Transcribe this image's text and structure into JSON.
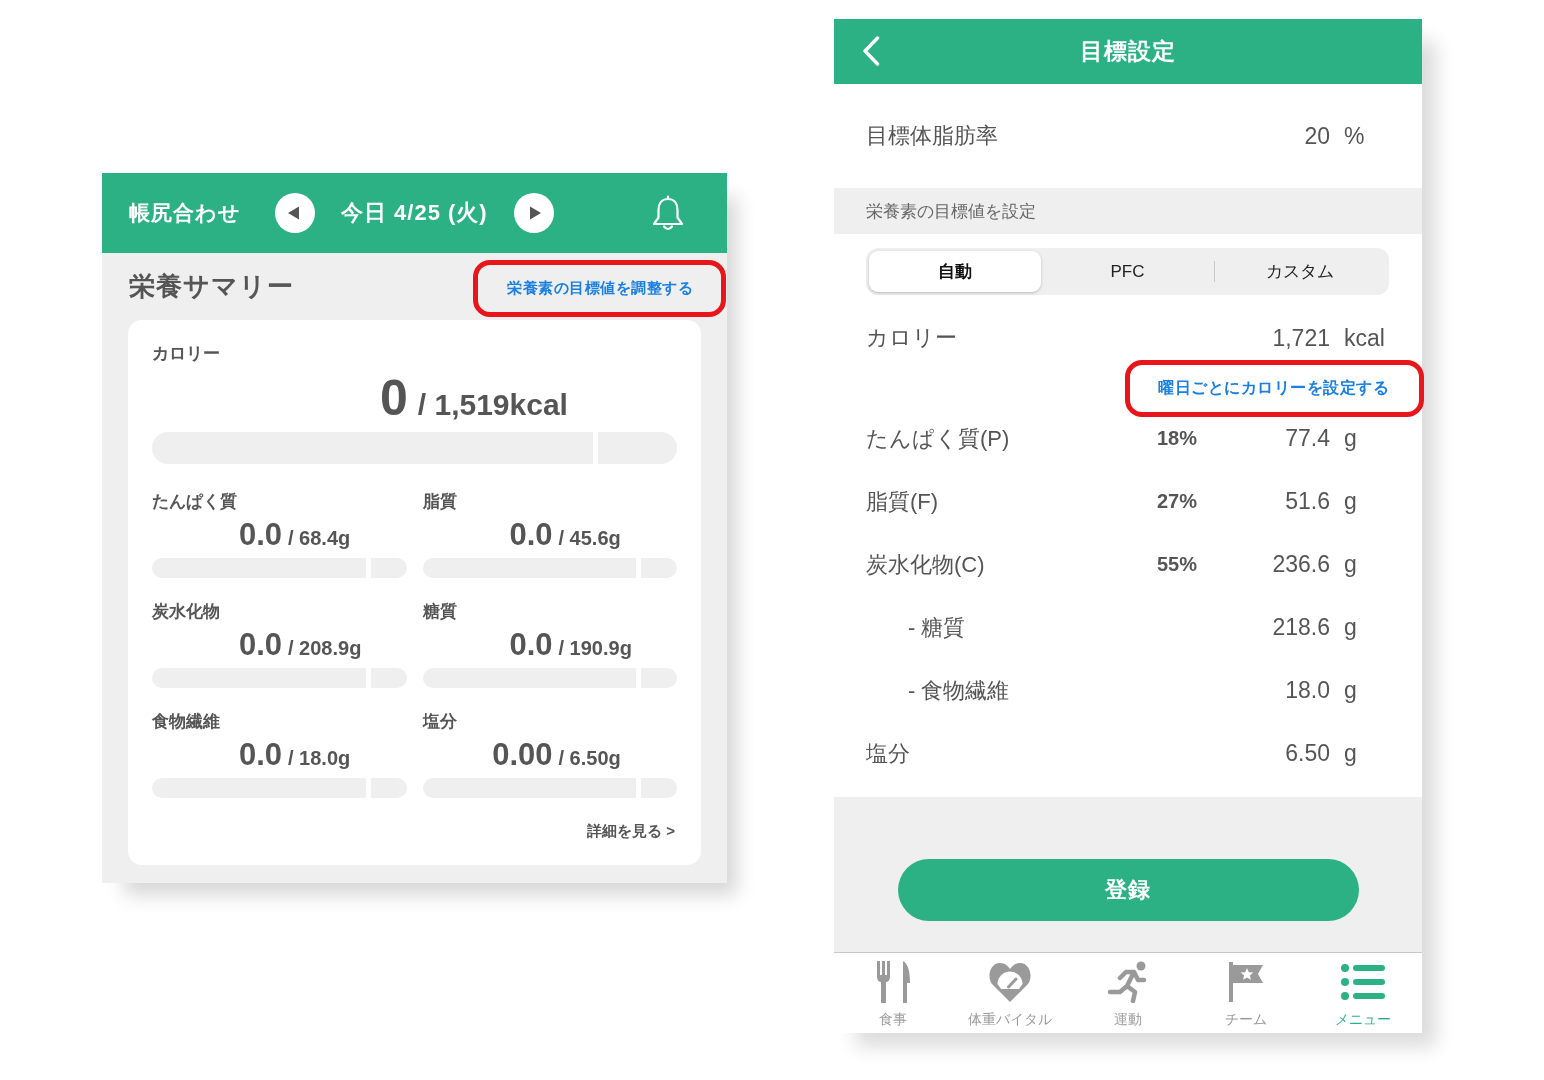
{
  "nutrition_summary": {
    "header": {
      "title": "帳尻合わせ",
      "date": "今日 4/25 (火)"
    },
    "section_title": "栄養サマリー",
    "adjust_link": {
      "label": "栄養素の目標値を調整する",
      "highlighted": true
    },
    "calorie": {
      "label": "カロリー",
      "value": "0",
      "target": "/ 1,519kcal",
      "level": 0
    },
    "nutrients": [
      {
        "label": "たんぱく質",
        "value": "0.0",
        "target": "/ 68.4g",
        "level": 0
      },
      {
        "label": "脂質",
        "value": "0.0",
        "target": "/ 45.6g",
        "level": 0
      },
      {
        "label": "炭水化物",
        "value": "0.0",
        "target": "/ 208.9g",
        "level": 0
      },
      {
        "label": "糖質",
        "value": "0.0",
        "target": "/ 190.9g",
        "level": 0
      },
      {
        "label": "食物繊維",
        "value": "0.0",
        "target": "/ 18.0g",
        "level": 0
      },
      {
        "label": "塩分",
        "value": "0.00",
        "target": "/ 6.50g",
        "level": 0
      }
    ],
    "details_link": "詳細を見る >"
  },
  "goal_settings": {
    "header": {
      "title": "目標設定"
    },
    "body_fat": {
      "label": "目標体脂肪率",
      "value": "20",
      "unit": "%"
    },
    "section_label": "栄養素の目標値を設定",
    "mode_tabs": [
      {
        "label": "自動",
        "selected": true
      },
      {
        "label": "PFC",
        "selected": false
      },
      {
        "label": "カスタム",
        "selected": false
      }
    ],
    "calorie": {
      "label": "カロリー",
      "value": "1,721",
      "unit": "kcal"
    },
    "weekday_link": {
      "label": "曜日ごとにカロリーを設定する",
      "highlighted": true
    },
    "nutrients": [
      {
        "kind": "main",
        "label": "たんぱく質(P)",
        "percent": "18%",
        "value": "77.4",
        "unit": "g"
      },
      {
        "kind": "main",
        "label": "脂質(F)",
        "percent": "27%",
        "value": "51.6",
        "unit": "g"
      },
      {
        "kind": "main",
        "label": "炭水化物(C)",
        "percent": "55%",
        "value": "236.6",
        "unit": "g"
      },
      {
        "kind": "sub",
        "label": "- 糖質",
        "value": "218.6",
        "unit": "g"
      },
      {
        "kind": "sub",
        "label": "- 食物繊維",
        "value": "18.0",
        "unit": "g"
      },
      {
        "kind": "main",
        "label": "塩分",
        "value": "6.50",
        "unit": "g"
      }
    ],
    "submit_button": "登録",
    "tab_bar": [
      {
        "label": "食事",
        "selected": false
      },
      {
        "label": "体重バイタル",
        "selected": false
      },
      {
        "label": "運動",
        "selected": false
      },
      {
        "label": "チーム",
        "selected": false
      },
      {
        "label": "メニュー",
        "selected": true
      }
    ]
  }
}
